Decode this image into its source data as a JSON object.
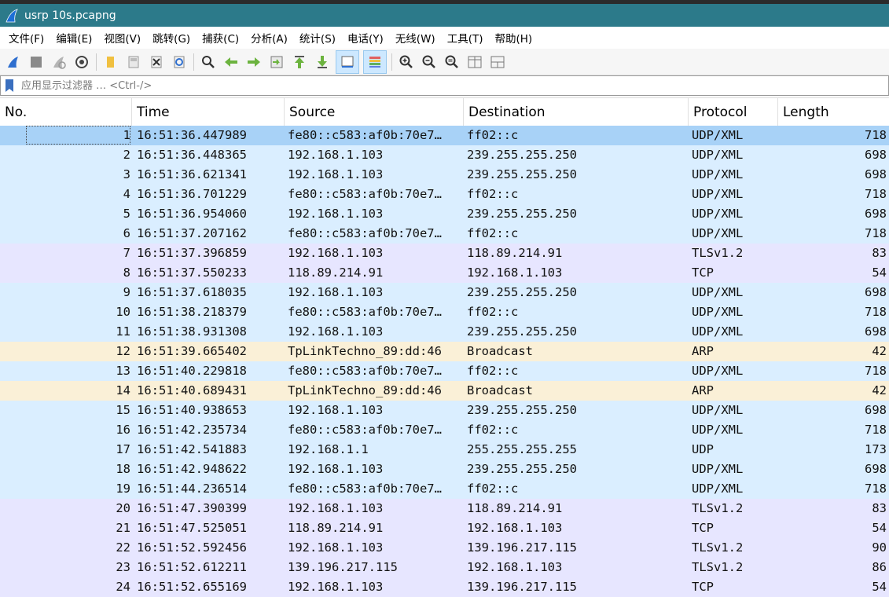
{
  "window": {
    "title": "usrp 10s.pcapng"
  },
  "menu": [
    "文件(F)",
    "编辑(E)",
    "视图(V)",
    "跳转(G)",
    "捕获(C)",
    "分析(A)",
    "统计(S)",
    "电话(Y)",
    "无线(W)",
    "工具(T)",
    "帮助(H)"
  ],
  "toolbar": {
    "icons": [
      "start-capture-icon",
      "stop-capture-icon",
      "restart-capture-icon",
      "capture-options-icon",
      "open-file-icon",
      "save-file-icon",
      "close-file-icon",
      "reload-file-icon",
      "find-packet-icon",
      "go-back-icon",
      "go-forward-icon",
      "go-to-packet-icon",
      "go-first-icon",
      "go-last-icon",
      "autoscroll-icon",
      "colorize-icon",
      "zoom-in-icon",
      "zoom-out-icon",
      "normal-size-icon",
      "resize-columns-icon",
      "layout-icon"
    ]
  },
  "filter": {
    "placeholder": "应用显示过滤器 … <Ctrl-/>"
  },
  "columns": {
    "no": "No.",
    "time": "Time",
    "source": "Source",
    "destination": "Destination",
    "protocol": "Protocol",
    "length": "Length"
  },
  "colors": {
    "udp": "#daeeff",
    "tcp": "#e7e6ff",
    "arp": "#faf0d7",
    "selected": "#a8d2f7",
    "title_bar": "#2c7a8a"
  },
  "packets": [
    {
      "no": "1",
      "time": "16:51:36.447989",
      "src": "fe80::c583:af0b:70e7…",
      "dst": "ff02::c",
      "proto": "UDP/XML",
      "len": "718",
      "color": "selected"
    },
    {
      "no": "2",
      "time": "16:51:36.448365",
      "src": "192.168.1.103",
      "dst": "239.255.255.250",
      "proto": "UDP/XML",
      "len": "698",
      "color": "udp"
    },
    {
      "no": "3",
      "time": "16:51:36.621341",
      "src": "192.168.1.103",
      "dst": "239.255.255.250",
      "proto": "UDP/XML",
      "len": "698",
      "color": "udp"
    },
    {
      "no": "4",
      "time": "16:51:36.701229",
      "src": "fe80::c583:af0b:70e7…",
      "dst": "ff02::c",
      "proto": "UDP/XML",
      "len": "718",
      "color": "udp"
    },
    {
      "no": "5",
      "time": "16:51:36.954060",
      "src": "192.168.1.103",
      "dst": "239.255.255.250",
      "proto": "UDP/XML",
      "len": "698",
      "color": "udp"
    },
    {
      "no": "6",
      "time": "16:51:37.207162",
      "src": "fe80::c583:af0b:70e7…",
      "dst": "ff02::c",
      "proto": "UDP/XML",
      "len": "718",
      "color": "udp"
    },
    {
      "no": "7",
      "time": "16:51:37.396859",
      "src": "192.168.1.103",
      "dst": "118.89.214.91",
      "proto": "TLSv1.2",
      "len": "83",
      "color": "tcp"
    },
    {
      "no": "8",
      "time": "16:51:37.550233",
      "src": "118.89.214.91",
      "dst": "192.168.1.103",
      "proto": "TCP",
      "len": "54",
      "color": "tcp"
    },
    {
      "no": "9",
      "time": "16:51:37.618035",
      "src": "192.168.1.103",
      "dst": "239.255.255.250",
      "proto": "UDP/XML",
      "len": "698",
      "color": "udp"
    },
    {
      "no": "10",
      "time": "16:51:38.218379",
      "src": "fe80::c583:af0b:70e7…",
      "dst": "ff02::c",
      "proto": "UDP/XML",
      "len": "718",
      "color": "udp"
    },
    {
      "no": "11",
      "time": "16:51:38.931308",
      "src": "192.168.1.103",
      "dst": "239.255.255.250",
      "proto": "UDP/XML",
      "len": "698",
      "color": "udp"
    },
    {
      "no": "12",
      "time": "16:51:39.665402",
      "src": "TpLinkTechno_89:dd:46",
      "dst": "Broadcast",
      "proto": "ARP",
      "len": "42",
      "color": "arp"
    },
    {
      "no": "13",
      "time": "16:51:40.229818",
      "src": "fe80::c583:af0b:70e7…",
      "dst": "ff02::c",
      "proto": "UDP/XML",
      "len": "718",
      "color": "udp"
    },
    {
      "no": "14",
      "time": "16:51:40.689431",
      "src": "TpLinkTechno_89:dd:46",
      "dst": "Broadcast",
      "proto": "ARP",
      "len": "42",
      "color": "arp"
    },
    {
      "no": "15",
      "time": "16:51:40.938653",
      "src": "192.168.1.103",
      "dst": "239.255.255.250",
      "proto": "UDP/XML",
      "len": "698",
      "color": "udp"
    },
    {
      "no": "16",
      "time": "16:51:42.235734",
      "src": "fe80::c583:af0b:70e7…",
      "dst": "ff02::c",
      "proto": "UDP/XML",
      "len": "718",
      "color": "udp"
    },
    {
      "no": "17",
      "time": "16:51:42.541883",
      "src": "192.168.1.1",
      "dst": "255.255.255.255",
      "proto": "UDP",
      "len": "173",
      "color": "udp"
    },
    {
      "no": "18",
      "time": "16:51:42.948622",
      "src": "192.168.1.103",
      "dst": "239.255.255.250",
      "proto": "UDP/XML",
      "len": "698",
      "color": "udp"
    },
    {
      "no": "19",
      "time": "16:51:44.236514",
      "src": "fe80::c583:af0b:70e7…",
      "dst": "ff02::c",
      "proto": "UDP/XML",
      "len": "718",
      "color": "udp"
    },
    {
      "no": "20",
      "time": "16:51:47.390399",
      "src": "192.168.1.103",
      "dst": "118.89.214.91",
      "proto": "TLSv1.2",
      "len": "83",
      "color": "tcp"
    },
    {
      "no": "21",
      "time": "16:51:47.525051",
      "src": "118.89.214.91",
      "dst": "192.168.1.103",
      "proto": "TCP",
      "len": "54",
      "color": "tcp"
    },
    {
      "no": "22",
      "time": "16:51:52.592456",
      "src": "192.168.1.103",
      "dst": "139.196.217.115",
      "proto": "TLSv1.2",
      "len": "90",
      "color": "tcp"
    },
    {
      "no": "23",
      "time": "16:51:52.612211",
      "src": "139.196.217.115",
      "dst": "192.168.1.103",
      "proto": "TLSv1.2",
      "len": "86",
      "color": "tcp"
    },
    {
      "no": "24",
      "time": "16:51:52.655169",
      "src": "192.168.1.103",
      "dst": "139.196.217.115",
      "proto": "TCP",
      "len": "54",
      "color": "tcp"
    }
  ]
}
